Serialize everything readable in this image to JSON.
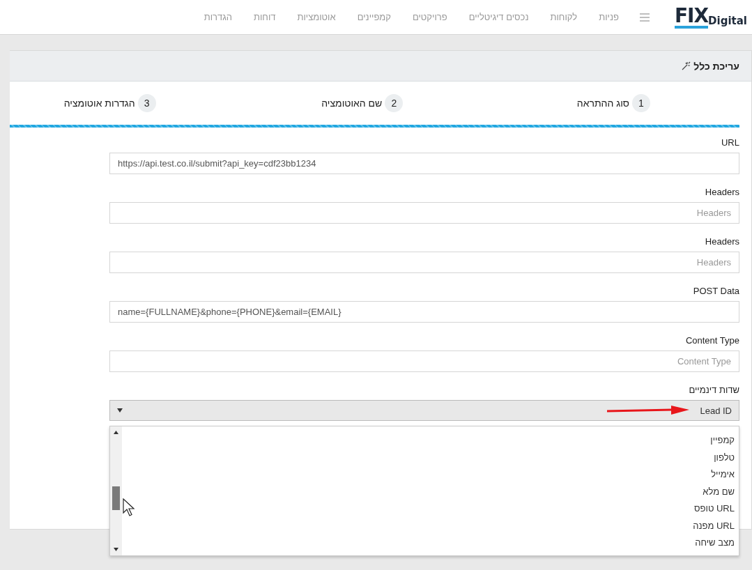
{
  "logo": {
    "mark": "FIX",
    "word": "Digital"
  },
  "nav": [
    {
      "label": "פניות"
    },
    {
      "label": "לקוחות"
    },
    {
      "label": "נכסים דיגיטליים"
    },
    {
      "label": "פרויקטים"
    },
    {
      "label": "קמפיינים"
    },
    {
      "label": "אוטומציות"
    },
    {
      "label": "דוחות"
    },
    {
      "label": "הגדרות"
    }
  ],
  "card": {
    "title": "עריכת כלל"
  },
  "steps": [
    {
      "number": "1",
      "label": "סוג ההתראה"
    },
    {
      "number": "2",
      "label": "שם האוטומציה"
    },
    {
      "number": "3",
      "label": "הגדרות אוטומציה"
    }
  ],
  "fields": [
    {
      "label": "URL",
      "value": "https://api.test.co.il/submit?api_key=cdf23bb1234"
    },
    {
      "label": "Headers",
      "placeholder": "Headers"
    },
    {
      "label": "Headers",
      "placeholder": "Headers"
    },
    {
      "label": "POST Data",
      "value": "name={FULLNAME}&phone={PHONE}&email={EMAIL}"
    },
    {
      "label": "Content Type",
      "placeholder": "Content Type"
    }
  ],
  "dynamic_fields": {
    "label": "שדות דינמיים",
    "value": "Lead ID",
    "expanded": true,
    "options": [
      {
        "label": "קמפיין"
      },
      {
        "label": "טלפון"
      },
      {
        "label": "אימייל"
      },
      {
        "label": "שם מלא"
      },
      {
        "label": "URL טופס"
      },
      {
        "label": "URL מפנה"
      },
      {
        "label": "מצב שיחה"
      }
    ]
  }
}
